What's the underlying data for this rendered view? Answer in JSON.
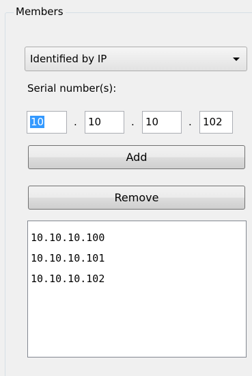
{
  "group": {
    "title": "Members"
  },
  "identify": {
    "selected": "Identified by IP"
  },
  "serial": {
    "label": "Serial number(s):"
  },
  "ip": {
    "octets": [
      "10",
      "10",
      "10",
      "102"
    ],
    "separator": "."
  },
  "buttons": {
    "add": "Add",
    "remove": "Remove"
  },
  "members": {
    "items": [
      "10.10.10.100",
      "10.10.10.101",
      "10.10.10.102"
    ]
  },
  "colors": {
    "selection": "#3399ff",
    "background": "#f0f0f0"
  },
  "icons": {
    "dropdown": "chevron-down-icon"
  }
}
